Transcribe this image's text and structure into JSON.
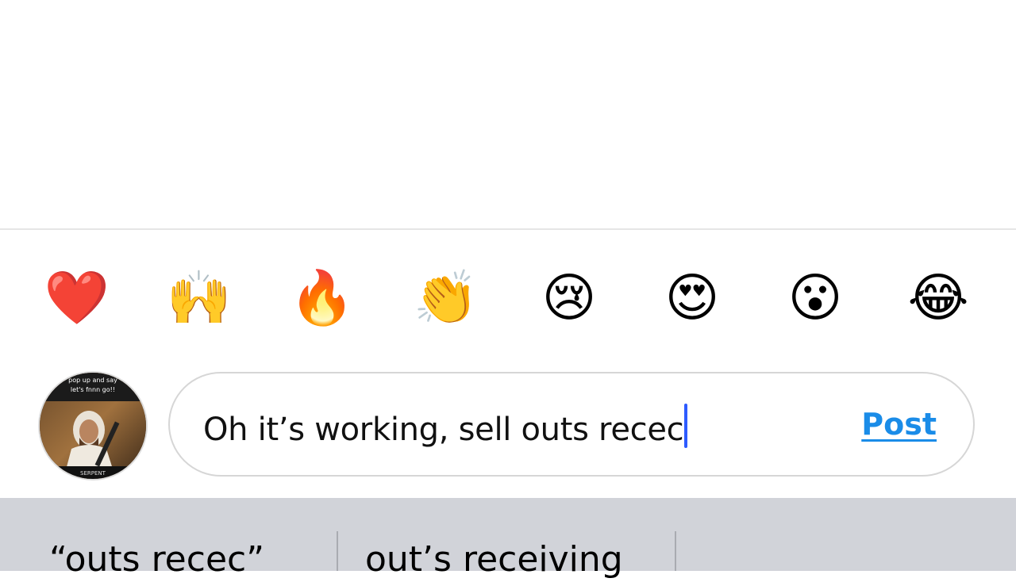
{
  "emoji_reactions": [
    {
      "emoji": "❤️",
      "name": "red-heart"
    },
    {
      "emoji": "🙌",
      "name": "raising-hands"
    },
    {
      "emoji": "🔥",
      "name": "fire"
    },
    {
      "emoji": "👏",
      "name": "clapping-hands"
    },
    {
      "emoji": "😢",
      "name": "crying-face"
    },
    {
      "emoji": "😍",
      "name": "heart-eyes"
    },
    {
      "emoji": "😮",
      "name": "surprised-face"
    },
    {
      "emoji": "😂",
      "name": "tears-of-joy"
    }
  ],
  "avatar": {
    "icon": "profile-avatar-image",
    "overlay_text_top": "pop up and say",
    "overlay_text_line2": "let's fnnn go!!",
    "overlay_text_bottom": "SERPENT"
  },
  "comment": {
    "input_value": "Oh it’s working, sell outs recec",
    "post_label": "Post",
    "post_color": "#1a8ce8",
    "caret_color": "#2e5bff"
  },
  "keyboard": {
    "suggestions": [
      "“outs recec”",
      "out’s receiving"
    ]
  }
}
